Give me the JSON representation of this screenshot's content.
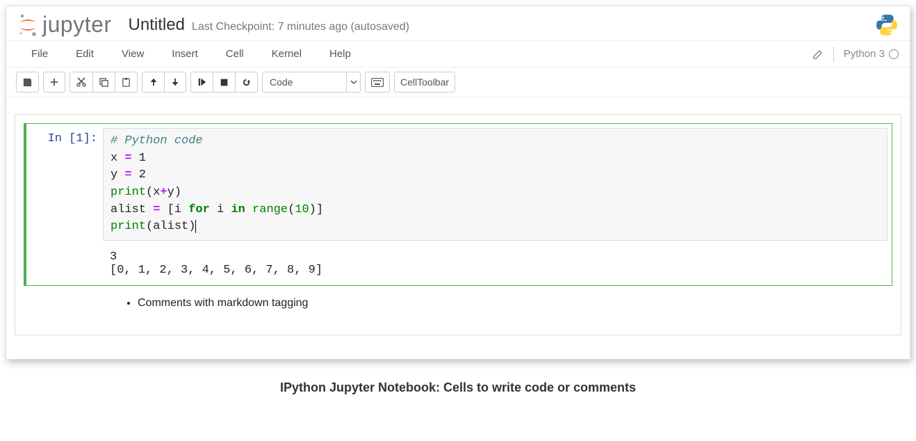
{
  "header": {
    "logo_text": "jupyter",
    "title": "Untitled",
    "checkpoint": "Last Checkpoint: 7 minutes ago (autosaved)"
  },
  "menubar": {
    "items": [
      "File",
      "Edit",
      "View",
      "Insert",
      "Cell",
      "Kernel",
      "Help"
    ],
    "kernel_name": "Python 3"
  },
  "toolbar": {
    "cell_type_selected": "Code",
    "celltoolbar_label": "CellToolbar",
    "icons": {
      "save": "save-icon",
      "add": "plus-icon",
      "cut": "scissors-icon",
      "copy": "copy-icon",
      "paste": "paste-icon",
      "up": "arrow-up-icon",
      "down": "arrow-down-icon",
      "run": "step-forward-icon",
      "stop": "stop-icon",
      "restart": "refresh-icon",
      "keyboard": "keyboard-icon"
    }
  },
  "cell": {
    "prompt": "In [1]:",
    "code": {
      "line1_comment": "# Python code",
      "line2_a": "x ",
      "line2_eq": "=",
      "line2_b": " 1",
      "line3_a": "y ",
      "line3_eq": "=",
      "line3_b": " 2",
      "line4_print": "print",
      "line4_open": "(",
      "line4_x": "x",
      "line4_plus": "+",
      "line4_y": "y",
      "line4_close": ")",
      "line5_a": "alist ",
      "line5_eq": "=",
      "line5_b": " [i ",
      "line5_for": "for",
      "line5_c": " i ",
      "line5_in": "in",
      "line5_d": " ",
      "line5_range": "range",
      "line5_e": "(",
      "line5_num": "10",
      "line5_f": ")]",
      "line6_print": "print",
      "line6_open": "(",
      "line6_arg": "alist",
      "line6_close": ")"
    },
    "output_line1": "3",
    "output_line2": "[0, 1, 2, 3, 4, 5, 6, 7, 8, 9]"
  },
  "markdown": {
    "bullet1": "Comments with markdown tagging"
  },
  "caption": "IPython Jupyter Notebook: Cells to write code or comments"
}
